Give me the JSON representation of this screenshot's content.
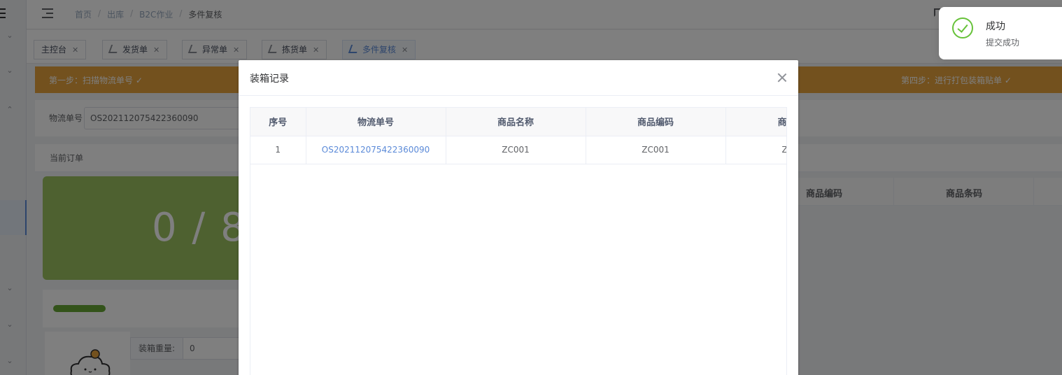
{
  "breadcrumb": [
    "首页",
    "出库",
    "B2C作业",
    "多件复核"
  ],
  "tags": [
    {
      "label": "主控台",
      "icon": "none"
    },
    {
      "label": "发货单",
      "icon": "chart-icon"
    },
    {
      "label": "异常单",
      "icon": "chart-icon"
    },
    {
      "label": "拣货单",
      "icon": "chart-icon"
    },
    {
      "label": "多件复核",
      "icon": "chart-icon",
      "active": true
    }
  ],
  "steps": {
    "step1": "第一步：扫描物流单号 ✓",
    "step4": "第四步：进行打包装箱贴单 ✓"
  },
  "form": {
    "tracking_label": "物流单号",
    "tracking_value": "OS202112075422360090",
    "weight_label": "装箱重量:",
    "weight_value": "0"
  },
  "order_section": {
    "title": "当前订单",
    "counter": "0 / 8",
    "progress_fraction": 0.25,
    "bg_headers": [
      "商品编码",
      "商品条码"
    ]
  },
  "dialog": {
    "title": "装箱记录",
    "columns": [
      "序号",
      "物流单号",
      "商品名称",
      "商品编码",
      "商"
    ],
    "rows": [
      [
        "1",
        "OS202112075422360090",
        "ZC001",
        "ZC001",
        "Z"
      ]
    ]
  },
  "notification": {
    "title": "成功",
    "message": "提交成功",
    "status_color": "#67c23a"
  },
  "colors": {
    "accent": "#5b8ad8",
    "steps_bg": "#e6a23c",
    "counter_bg": "#9dc360"
  }
}
